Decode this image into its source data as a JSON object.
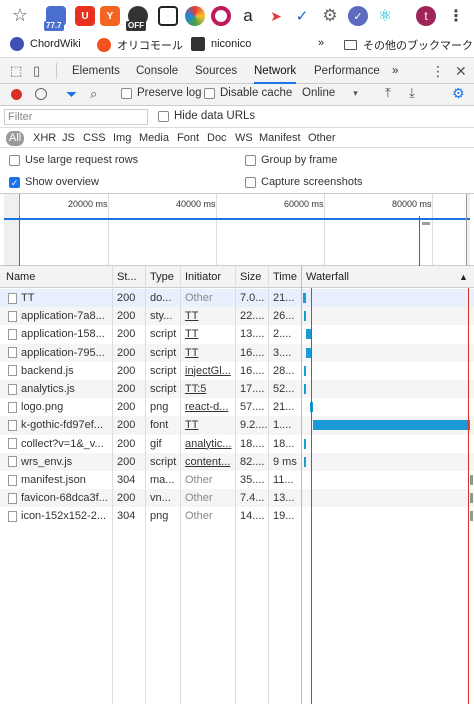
{
  "browser": {
    "extension_badges": {
      "count": "77.7",
      "off": "OFF"
    },
    "extension_letters": {
      "red_box": "U",
      "orange_box": "Y",
      "amazon": "a",
      "profile_initial": "t"
    },
    "bookmarks": [
      {
        "label": "ChordWiki",
        "icon": "chordwiki-icon"
      },
      {
        "label": "オリコモール",
        "icon": "orico-icon"
      },
      {
        "label": "niconico",
        "icon": "niconico-icon"
      }
    ],
    "bookmarks_overflow": "»",
    "other_bookmarks": "その他のブックマーク"
  },
  "devtools": {
    "tabs": [
      "Elements",
      "Console",
      "Sources",
      "Network",
      "Performance"
    ],
    "active_tab": "Network",
    "more_tabs": "»"
  },
  "network": {
    "toolbar": {
      "preserve_log": "Preserve log",
      "disable_cache": "Disable cache",
      "throttling": "Online"
    },
    "filter": {
      "placeholder": "Filter",
      "hide_data_urls": "Hide data URLs"
    },
    "type_filters": [
      "All",
      "XHR",
      "JS",
      "CSS",
      "Img",
      "Media",
      "Font",
      "Doc",
      "WS",
      "Manifest",
      "Other"
    ],
    "options": {
      "large_rows": "Use large request rows",
      "group_by_frame": "Group by frame",
      "show_overview": "Show overview",
      "capture_screenshots": "Capture screenshots"
    },
    "overview_ticks": [
      "20000 ms",
      "40000 ms",
      "60000 ms",
      "80000 ms"
    ],
    "columns": {
      "name": "Name",
      "status": "St...",
      "type": "Type",
      "initiator": "Initiator",
      "size": "Size",
      "time": "Time",
      "waterfall": "Waterfall"
    },
    "requests": [
      {
        "name": "TT",
        "status": "200",
        "type": "do...",
        "initiator": "Other",
        "initiator_link": false,
        "size": "7.0...",
        "time": "21..."
      },
      {
        "name": "application-7a8...",
        "status": "200",
        "type": "sty...",
        "initiator": "TT",
        "initiator_link": true,
        "size": "22....",
        "time": "26..."
      },
      {
        "name": "application-158...",
        "status": "200",
        "type": "script",
        "initiator": "TT",
        "initiator_link": true,
        "size": "13....",
        "time": "2...."
      },
      {
        "name": "application-795...",
        "status": "200",
        "type": "script",
        "initiator": "TT",
        "initiator_link": true,
        "size": "16....",
        "time": "3...."
      },
      {
        "name": "backend.js",
        "status": "200",
        "type": "script",
        "initiator": "injectGl...",
        "initiator_link": true,
        "size": "16....",
        "time": "28..."
      },
      {
        "name": "analytics.js",
        "status": "200",
        "type": "script",
        "initiator": "TT:5",
        "initiator_link": true,
        "size": "17....",
        "time": "52..."
      },
      {
        "name": "logo.png",
        "status": "200",
        "type": "png",
        "initiator": "react-d...",
        "initiator_link": true,
        "size": "57....",
        "time": "21..."
      },
      {
        "name": "k-gothic-fd97ef...",
        "status": "200",
        "type": "font",
        "initiator": "TT",
        "initiator_link": true,
        "size": "9.2....",
        "time": "1...."
      },
      {
        "name": "collect?v=1&_v...",
        "status": "200",
        "type": "gif",
        "initiator": "analytic...",
        "initiator_link": true,
        "size": "18....",
        "time": "18..."
      },
      {
        "name": "wrs_env.js",
        "status": "200",
        "type": "script",
        "initiator": "content...",
        "initiator_link": true,
        "size": "82....",
        "time": "9 ms"
      },
      {
        "name": "manifest.json",
        "status": "304",
        "type": "ma...",
        "initiator": "Other",
        "initiator_link": false,
        "size": "35....",
        "time": "11..."
      },
      {
        "name": "favicon-68dca3f...",
        "status": "200",
        "type": "vn...",
        "initiator": "Other",
        "initiator_link": false,
        "size": "7.4...",
        "time": "13..."
      },
      {
        "name": "icon-152x152-2...",
        "status": "304",
        "type": "png",
        "initiator": "Other",
        "initiator_link": false,
        "size": "14....",
        "time": "19..."
      }
    ]
  },
  "colors": {
    "accent": "#1a73e8",
    "record": "#d93025",
    "waterfall_bar": "#1a9bd7"
  }
}
